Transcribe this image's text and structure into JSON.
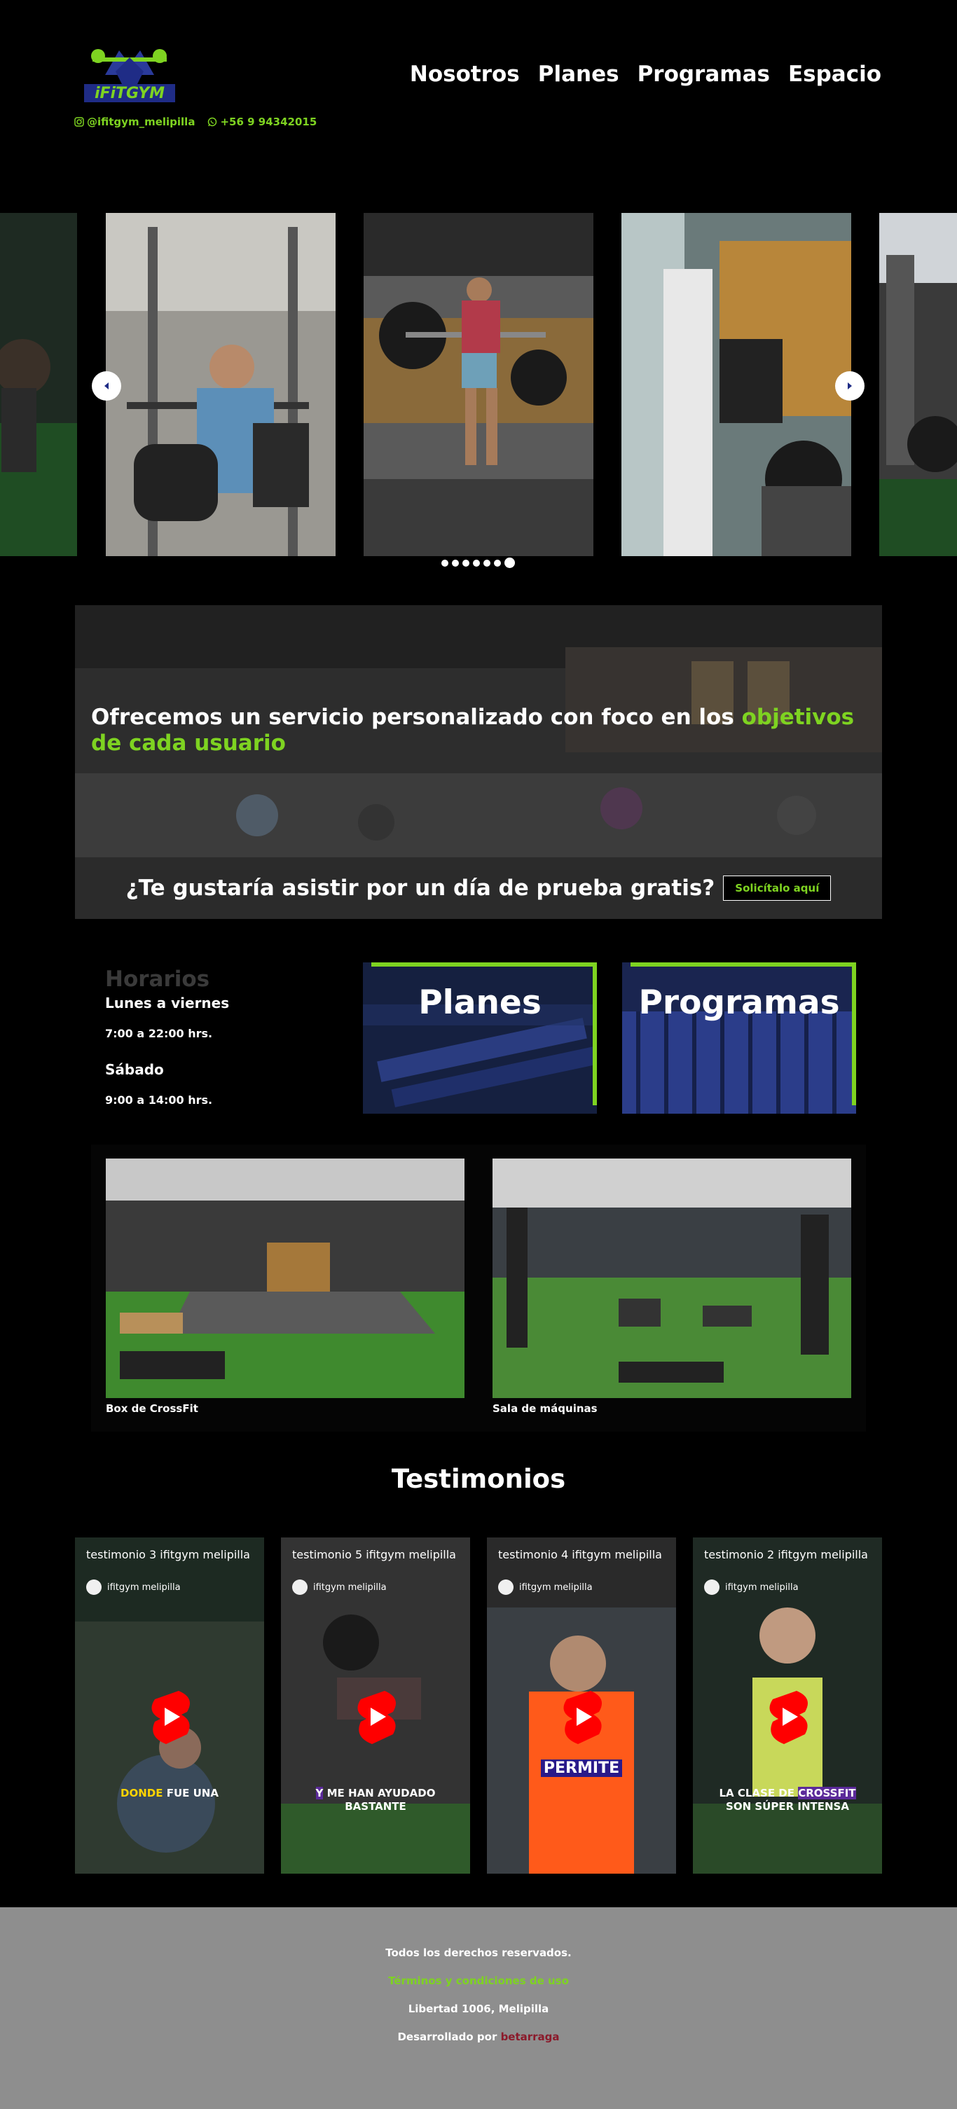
{
  "header": {
    "social": {
      "instagram": "@ifitgym_melipilla",
      "whatsapp": "+56 9 94342015"
    },
    "nav": [
      "Nosotros",
      "Planes",
      "Programas",
      "Espacio"
    ]
  },
  "carousel": {
    "slide_count": 7,
    "active_index": 6
  },
  "banner": {
    "title_plain": "Ofrecemos un servicio personalizado con foco en los ",
    "title_highlight": "objetivos de cada usuario",
    "question": "¿Te gustaría asistir por un día de prueba gratis?",
    "cta": "Solicítalo aquí"
  },
  "horarios": {
    "title": "Horarios",
    "weekdays": "Lunes a viernes",
    "weekdays_time": "7:00 a 22:00 hrs.",
    "saturday": "Sábado",
    "saturday_time": "9:00 a 14:00 hrs."
  },
  "cards": {
    "planes": "Planes",
    "programas": "Programas"
  },
  "spaces": [
    {
      "caption": "Box de CrossFit"
    },
    {
      "caption": "Sala de máquinas"
    }
  ],
  "testimonios": {
    "title": "Testimonios",
    "channel": "ifitgym melipilla",
    "items": [
      {
        "title": "testimonio 3 ifitgym melipilla",
        "caption": "DONDE FUE UNA",
        "highlight": "DONDE"
      },
      {
        "title": "testimonio 5 ifitgym melipilla",
        "caption": "Y ME HAN AYUDADO BASTANTE",
        "highlight": "Y"
      },
      {
        "title": "testimonio 4 ifitgym melipilla",
        "caption": "PERMITE",
        "highlight": "PERMITE"
      },
      {
        "title": "testimonio 2 ifitgym melipilla",
        "caption": "LA CLASE DE CROSSFIT SON SÚPER INTENSA",
        "highlight": "CROSSFIT"
      }
    ]
  },
  "footer": {
    "rights": "Todos los derechos reservados.",
    "terms": "Términos y condiciones de uso",
    "address": "Libertad 1006, Melipilla",
    "dev_prefix": "Desarrollado por ",
    "dev_name": "betarraga"
  },
  "colors": {
    "accent": "#7ed321",
    "footer_bg": "#8e8e8e",
    "dev": "#8b1a2b",
    "youtube": "#ff0000"
  }
}
